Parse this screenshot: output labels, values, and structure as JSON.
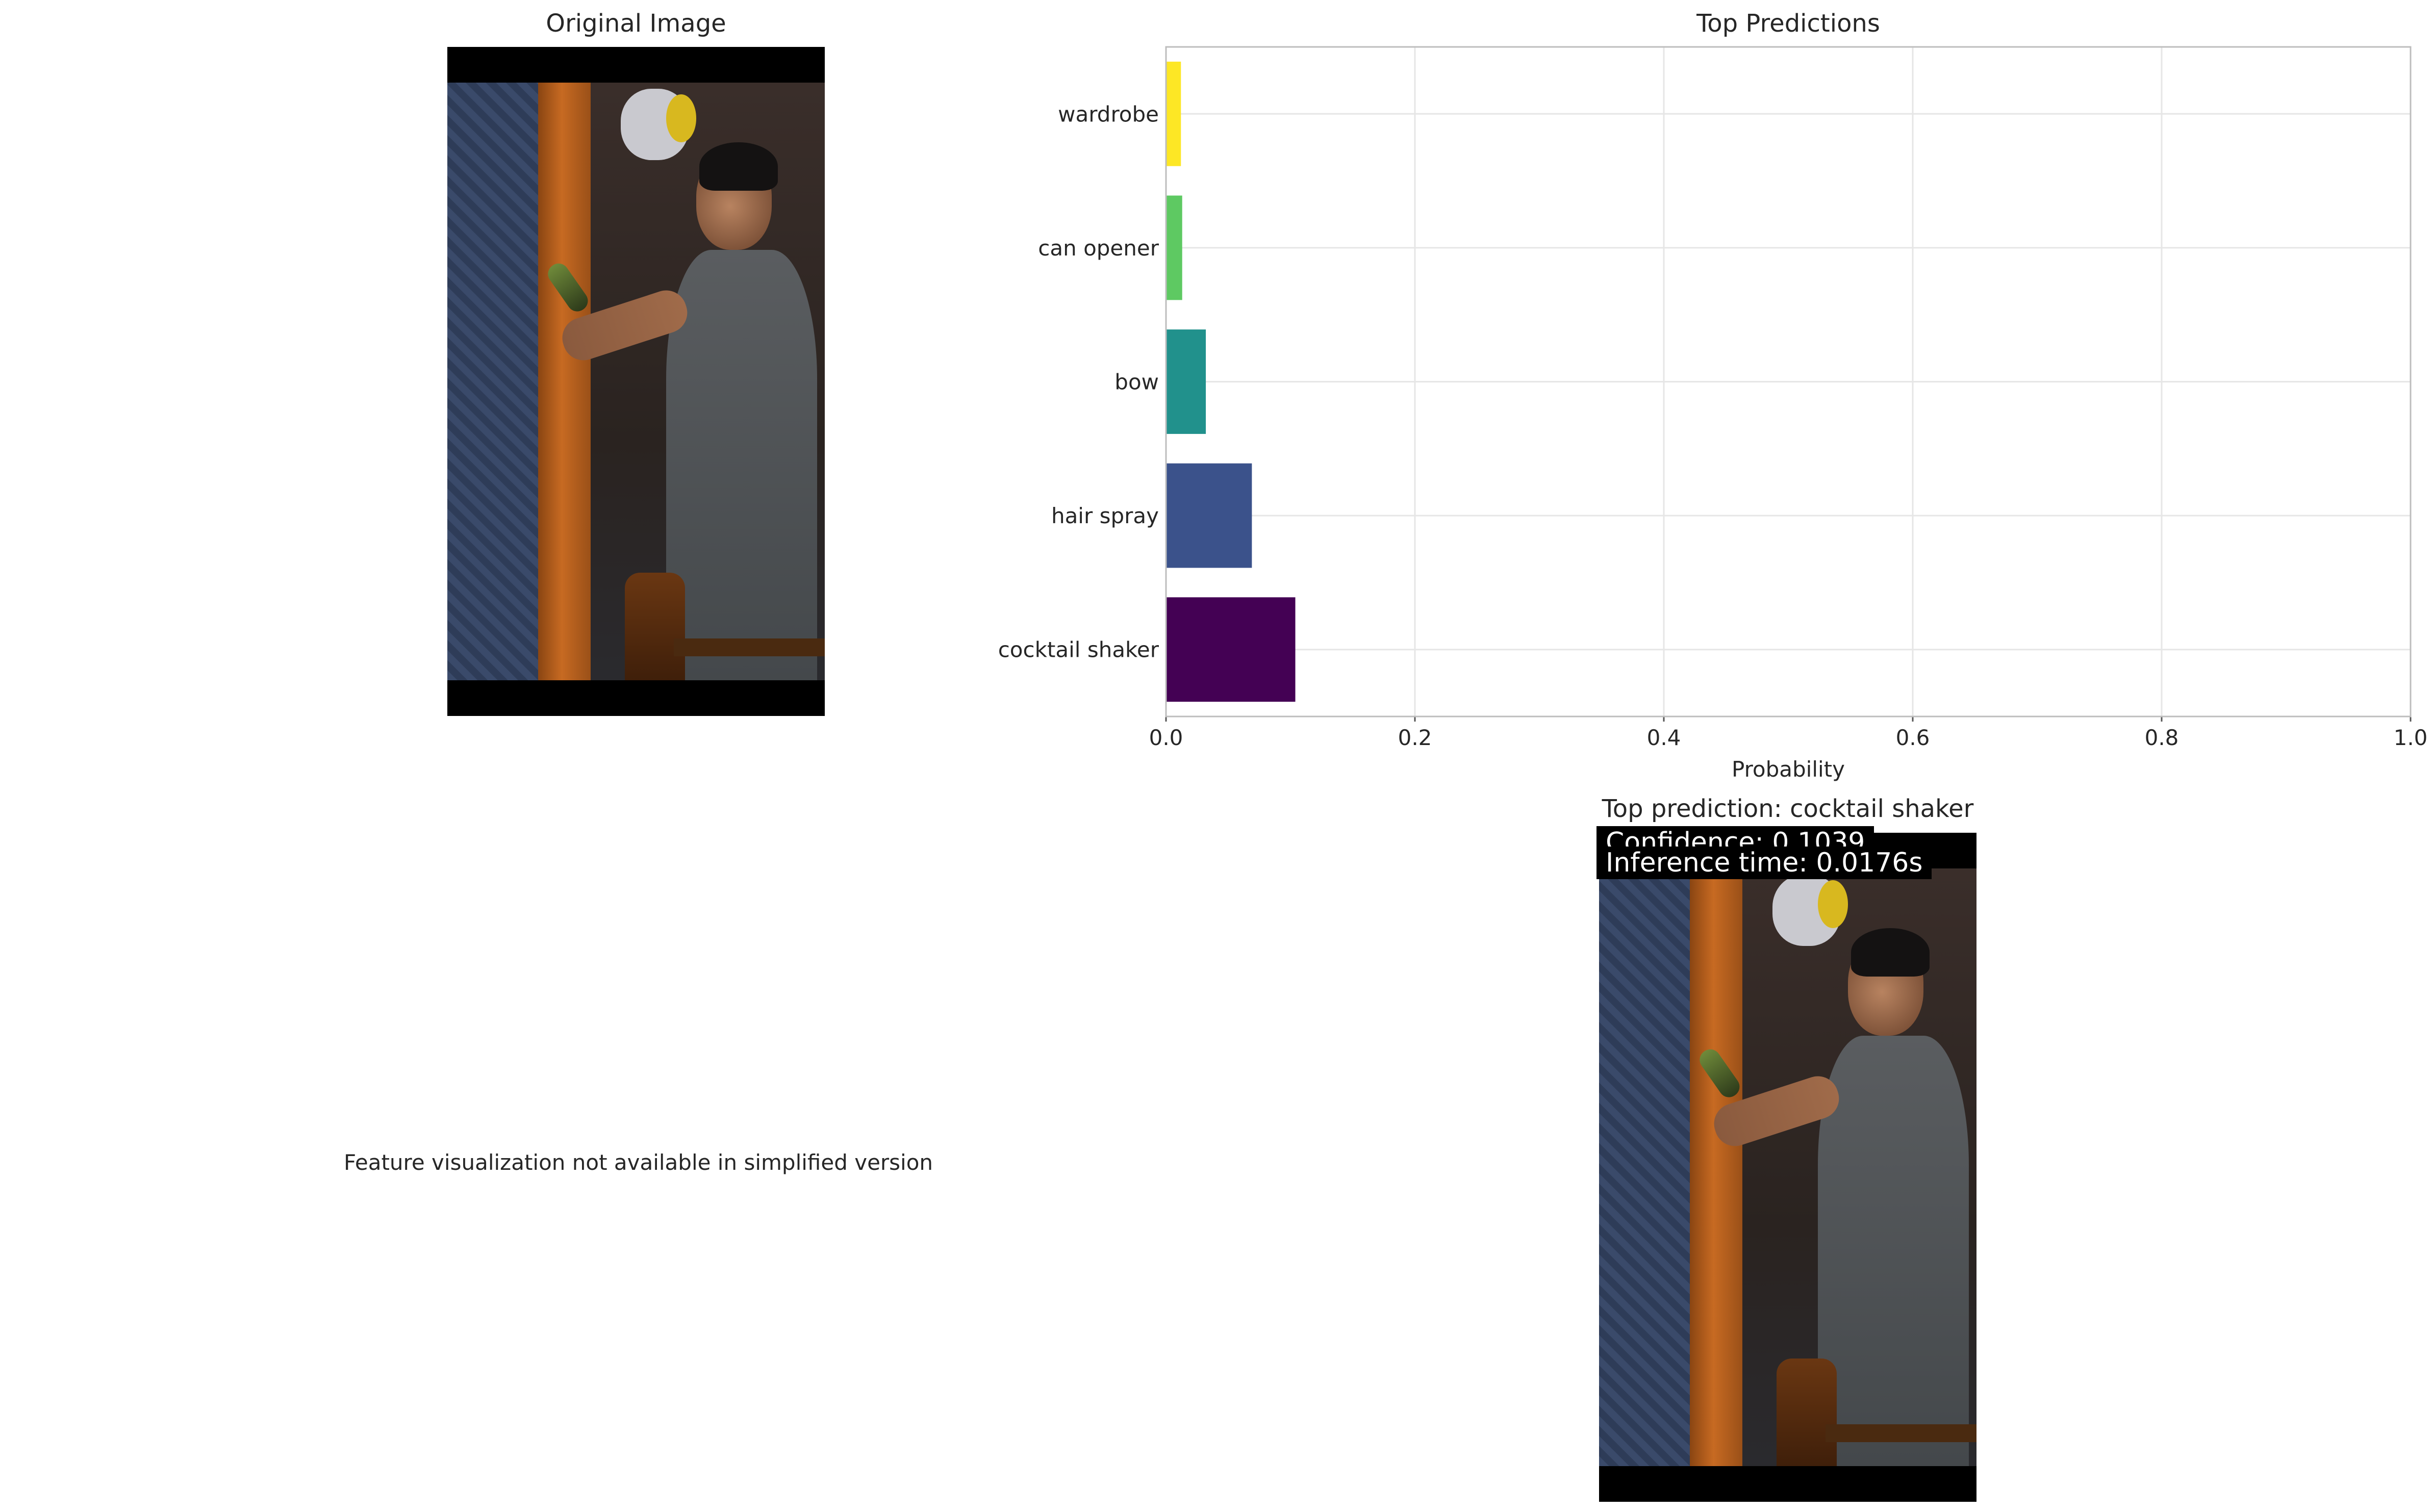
{
  "panels": {
    "original_title": "Original Image",
    "chart_title": "Top Predictions",
    "feature_text": "Feature visualization not available in simplified version",
    "result_title": "Top prediction: cocktail shaker",
    "confidence_text": "Confidence: 0.1039",
    "inference_text": "Inference time: 0.0176s"
  },
  "chart_data": {
    "type": "bar",
    "orientation": "horizontal",
    "title": "Top Predictions",
    "xlabel": "Probability",
    "ylabel": "",
    "categories": [
      "cocktail shaker",
      "hair spray",
      "bow",
      "can opener",
      "wardrobe"
    ],
    "values": [
      0.1039,
      0.069,
      0.032,
      0.013,
      0.012
    ],
    "colors": [
      "#440154",
      "#3b528b",
      "#21918c",
      "#5ec962",
      "#fde725"
    ],
    "xlim": [
      0,
      1.0
    ],
    "xticks": [
      "0.0",
      "0.2",
      "0.4",
      "0.6",
      "0.8",
      "1.0"
    ],
    "grid": true
  }
}
